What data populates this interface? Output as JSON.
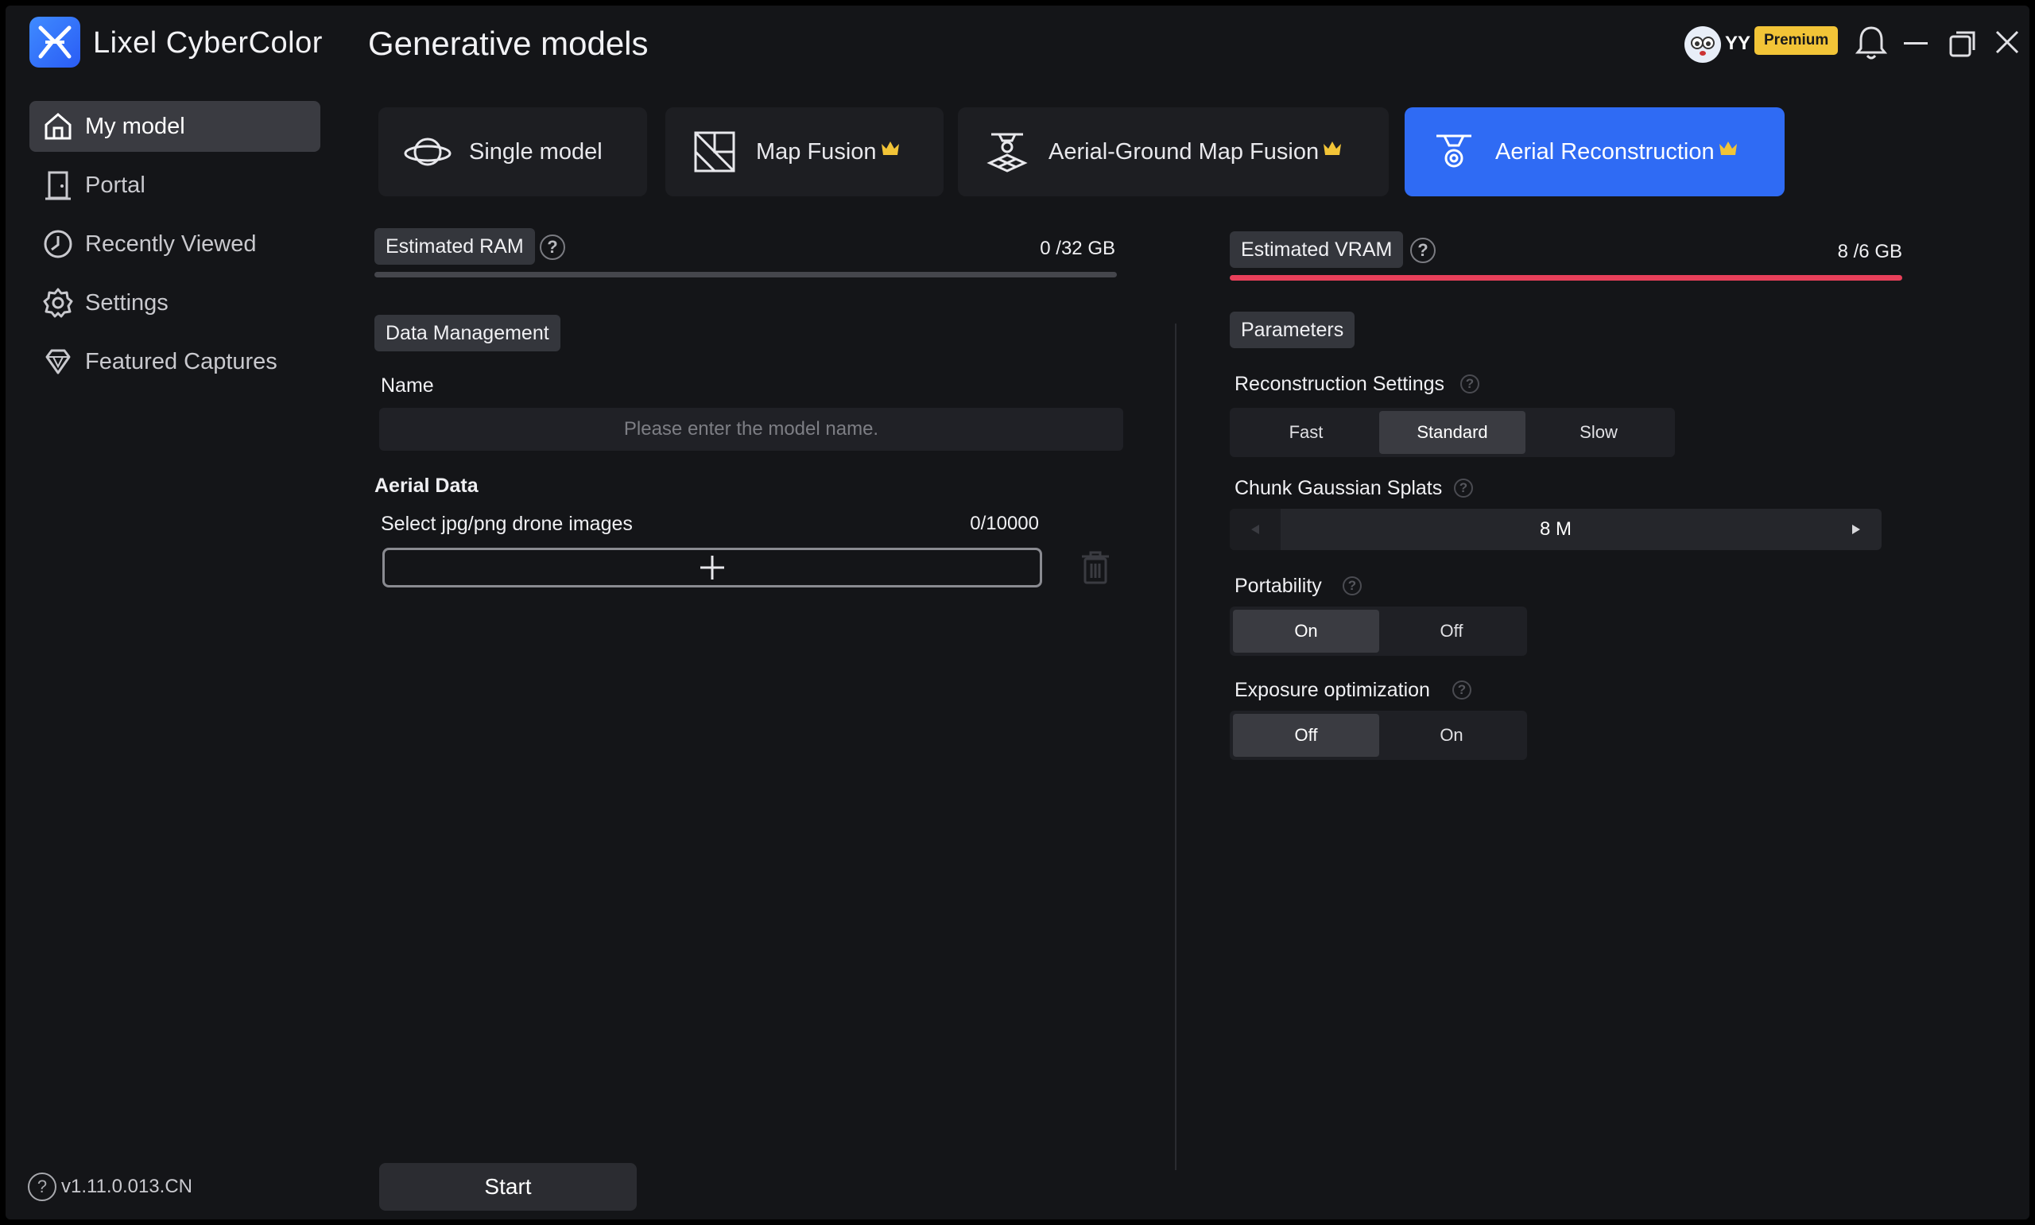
{
  "app": {
    "name": "Lixel CyberColor",
    "page_title": "Generative models"
  },
  "header": {
    "user_name": "YY",
    "badge": "Premium"
  },
  "sidebar": {
    "items": [
      {
        "label": "My model",
        "icon": "home-icon",
        "active": true
      },
      {
        "label": "Portal",
        "icon": "door-icon"
      },
      {
        "label": "Recently Viewed",
        "icon": "clock-icon"
      },
      {
        "label": "Settings",
        "icon": "gear-icon"
      },
      {
        "label": "Featured Captures",
        "icon": "diamond-icon"
      }
    ],
    "version": "v1.11.0.013.CN"
  },
  "tabs": [
    {
      "label": "Single model",
      "icon": "planet-icon",
      "premium": false
    },
    {
      "label": "Map Fusion",
      "icon": "map-fusion-icon",
      "premium": true
    },
    {
      "label": "Aerial-Ground Map Fusion",
      "icon": "drone-ground-icon",
      "premium": true
    },
    {
      "label": "Aerial Reconstruction",
      "icon": "drone-icon",
      "premium": true,
      "active": true
    }
  ],
  "left_panel": {
    "ram_label": "Estimated RAM",
    "ram_value": "0 /32 GB",
    "ram_fraction": 0,
    "data_management": "Data Management",
    "name_label": "Name",
    "name_placeholder": "Please enter the model name.",
    "aerial_data_label": "Aerial Data",
    "select_images_label": "Select jpg/png drone images",
    "image_count": "0/10000",
    "start_label": "Start"
  },
  "right_panel": {
    "vram_label": "Estimated VRAM",
    "vram_value": "8 /6 GB",
    "vram_fraction": 1,
    "parameters": "Parameters",
    "recon_settings_label": "Reconstruction Settings",
    "recon_options": [
      "Fast",
      "Standard",
      "Slow"
    ],
    "recon_selected": "Standard",
    "chunk_label": "Chunk Gaussian Splats",
    "chunk_value": "8 M",
    "portability_label": "Portability",
    "portability_options": [
      "On",
      "Off"
    ],
    "portability_selected": "On",
    "exposure_label": "Exposure optimization",
    "exposure_options": [
      "Off",
      "On"
    ],
    "exposure_selected": "Off"
  },
  "colors": {
    "accent": "#2f6bf4",
    "vram_bar": "#e8405a",
    "ram_bar": "#45464c",
    "premium": "#f2c437"
  }
}
